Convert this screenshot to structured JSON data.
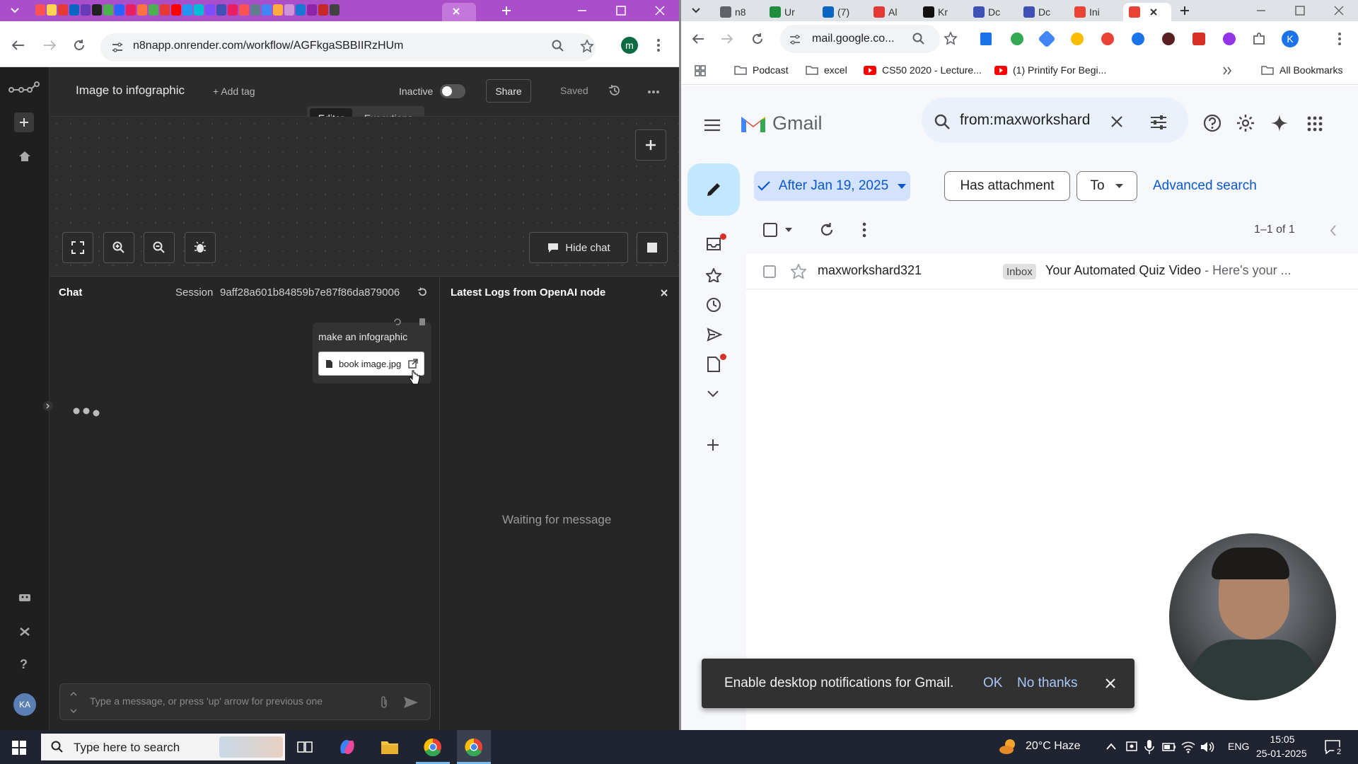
{
  "left_browser": {
    "address": "n8napp.onrender.com/workflow/AGFkgaSBBIIRzHUm",
    "profile_initial": "m"
  },
  "n8n": {
    "workflow_name": "Image to infographic",
    "add_tag": "+ Add tag",
    "status_label": "Inactive",
    "share_label": "Share",
    "saved_label": "Saved",
    "tabs": {
      "editor": "Editor",
      "executions": "Executions"
    },
    "hide_chat_label": "Hide chat",
    "chat": {
      "title": "Chat",
      "session_label": "Session",
      "session_id": "9aff28a601b84859b7e87f86da879006",
      "message_text": "make an infographic",
      "attachment_name": "book image.jpg",
      "input_placeholder": "Type a message, or press 'up' arrow for previous one"
    },
    "logs": {
      "title": "Latest Logs from OpenAI node",
      "waiting": "Waiting for message"
    },
    "avatar_initials": "KA"
  },
  "right_browser": {
    "tabs": [
      {
        "label": "n8",
        "color": "#5f6368"
      },
      {
        "label": "Ur",
        "color": "#1e8e3e"
      },
      {
        "label": "(7)",
        "color": "#0a66c2"
      },
      {
        "label": "Al",
        "color": "#e53935"
      },
      {
        "label": "Kr",
        "color": "#111111"
      },
      {
        "label": "Dc",
        "color": "#3f51b5"
      },
      {
        "label": "Dc",
        "color": "#3f51b5"
      },
      {
        "label": "Ini",
        "color": "#ea4335"
      }
    ],
    "address": "mail.google.co...",
    "profile_initial": "K",
    "bookmarks": [
      "Podcast",
      "excel",
      "CS50 2020 - Lecture...",
      "(1) Printify For Begi..."
    ],
    "all_bookmarks": "All Bookmarks"
  },
  "gmail": {
    "logo_text": "Gmail",
    "search_query": "from:maxworkshard",
    "filters": {
      "date": "After Jan 19, 2025",
      "attachment": "Has attachment",
      "to": "To",
      "advanced": "Advanced search"
    },
    "pagination": "1–1 of 1",
    "mail": {
      "sender": "maxworkshard321",
      "label": "Inbox",
      "subject": "Your Automated Quiz Video",
      "snippet": " - Here's your ..."
    },
    "notification": {
      "text": "Enable desktop notifications for Gmail.",
      "ok": "OK",
      "no_thanks": "No thanks"
    }
  },
  "taskbar": {
    "search_placeholder": "Type here to search",
    "weather": "20°C  Haze",
    "language": "ENG",
    "time": "15:05",
    "date": "25-01-2025",
    "notification_count": "2"
  }
}
